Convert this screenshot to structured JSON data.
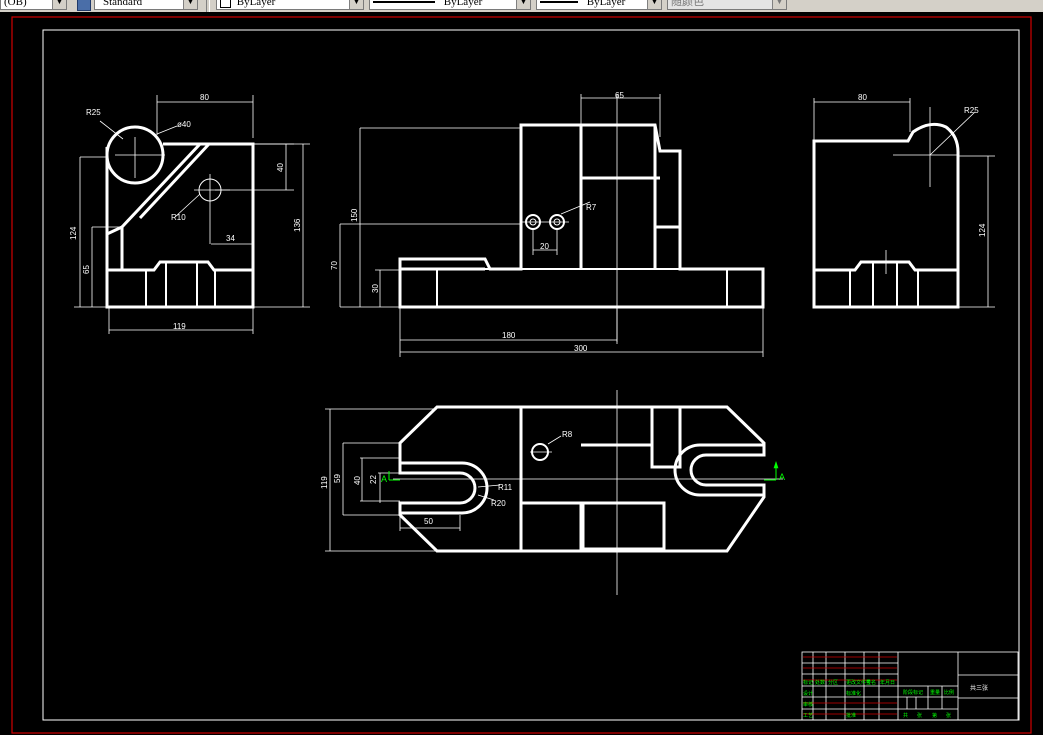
{
  "toolbar": {
    "text_style_value": "(OB)",
    "dim_style_value": "Standard",
    "layer_value": "ByLayer",
    "linetype_value": "ByLayer",
    "lineweight_value": "ByLayer",
    "color_value": "随颜色"
  },
  "drawing": {
    "colors": {
      "background": "#000000",
      "geometry": "#ffffff",
      "border": "#e00000",
      "section_marker": "#00ff00",
      "title_text": "#00ff00"
    },
    "front_view": {
      "dims": {
        "top_width": "80",
        "radius_top": "R25",
        "hole_dia": "ø40",
        "height_40": "40",
        "radius_small": "R10",
        "offset_34": "34",
        "height_124": "124",
        "height_65": "65",
        "height_136": "136",
        "width_119": "119"
      }
    },
    "side_view": {
      "dims": {
        "top_65": "65",
        "height_150": "150",
        "height_70": "70",
        "height_30": "30",
        "radius_r7": "R7",
        "pitch_20": "20",
        "length_180": "180",
        "length_300": "300"
      }
    },
    "right_view": {
      "dims": {
        "top_80": "80",
        "radius_r25": "R25",
        "height_124": "124"
      }
    },
    "top_view": {
      "dims": {
        "radius_r8": "R8",
        "height_119": "119",
        "height_59": "59",
        "height_40": "40",
        "height_22": "22",
        "radius_r11": "R11",
        "radius_r20": "R20",
        "width_50": "50"
      },
      "section_label_left": "A",
      "section_label_right": "A"
    },
    "title_block": {
      "drawing_name": "共三张",
      "cell_labels": [
        "标记",
        "处数",
        "分区",
        "更改文件号",
        "签名",
        "年月日",
        "设计",
        "标准化",
        "阶段标记",
        "重量",
        "比例",
        "审核",
        "工艺",
        "批准",
        "共",
        "张",
        "第",
        "张"
      ]
    }
  }
}
